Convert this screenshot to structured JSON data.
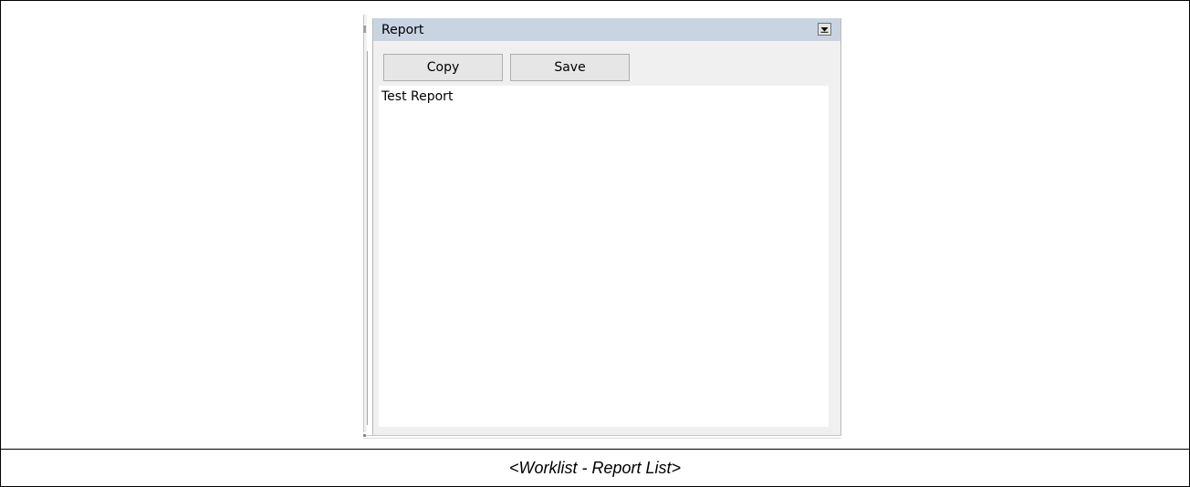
{
  "panel": {
    "title": "Report",
    "dropdown_icon": "chevron-down-icon"
  },
  "toolbar": {
    "copy_label": "Copy",
    "save_label": "Save"
  },
  "report": {
    "content": "Test Report"
  },
  "caption": {
    "text": "<Worklist - Report List>"
  },
  "colors": {
    "header_background": "#c8d4e2",
    "panel_background": "#f0f0f0",
    "report_background": "#ffffff"
  }
}
